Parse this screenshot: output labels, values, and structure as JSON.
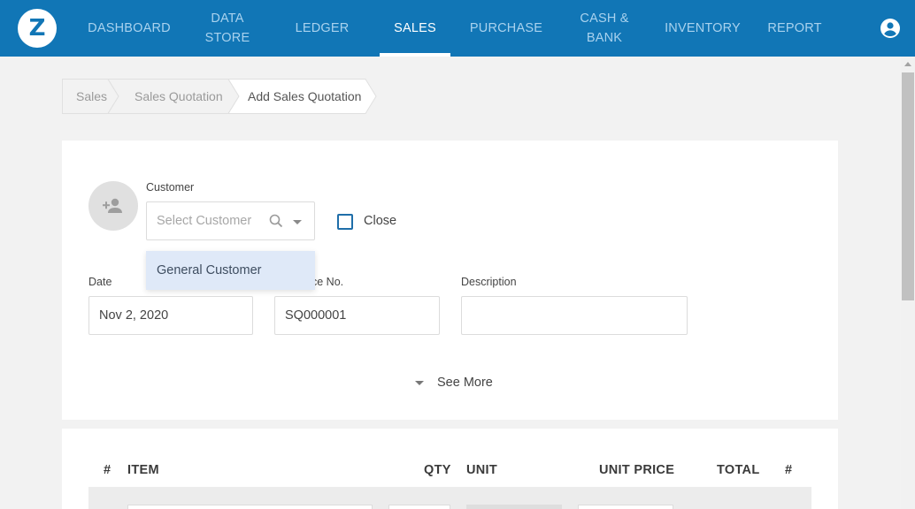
{
  "brand": {
    "logo_letter": "Z"
  },
  "nav": {
    "items": [
      {
        "label": "DASHBOARD"
      },
      {
        "line1": "DATA",
        "line2": "STORE"
      },
      {
        "label": "LEDGER"
      },
      {
        "label": "SALES",
        "active": true
      },
      {
        "label": "PURCHASE"
      },
      {
        "line1": "CASH &",
        "line2": "BANK"
      },
      {
        "label": "INVENTORY"
      },
      {
        "label": "REPORT"
      }
    ],
    "user_icon": "account-circle-icon"
  },
  "breadcrumb": [
    "Sales",
    "Sales Quotation",
    "Add Sales Quotation"
  ],
  "form": {
    "customer_label": "Customer",
    "customer_placeholder": "Select Customer",
    "close_label": "Close",
    "close_checked": false,
    "dropdown_option": "General Customer",
    "date_label": "Date",
    "date_value": "Nov 2, 2020",
    "invoice_label_visible": "ce No.",
    "invoice_value": "SQ000001",
    "description_label": "Description",
    "description_value": "",
    "see_more": "See More"
  },
  "items_table": {
    "columns": [
      "#",
      "ITEM",
      "QTY",
      "UNIT",
      "UNIT PRICE",
      "TOTAL",
      "#"
    ]
  },
  "colors": {
    "primary": "#1176b6",
    "nav_inactive": "#a9d2ee",
    "dropdown_highlight": "#dfe9f8",
    "checkbox_border": "#1f6ea9"
  }
}
